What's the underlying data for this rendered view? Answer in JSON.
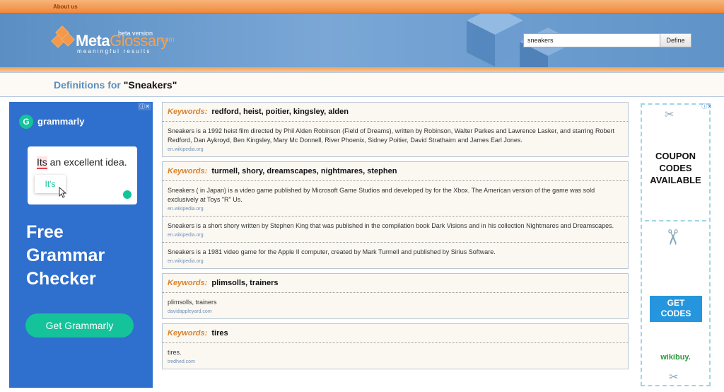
{
  "topbar": {
    "about": "About us"
  },
  "logo": {
    "meta": "Meta",
    "glossary": "Glossary",
    "beta": "beta version",
    "com": ".com",
    "tagline": "meaningful results"
  },
  "search": {
    "value": "sneakers",
    "button": "Define"
  },
  "heading": {
    "label": "Definitions for ",
    "term": "\"Sneakers\""
  },
  "ad_left": {
    "choices": "ⓘ✕",
    "brand": "grammarly",
    "sentence_underlined": "Its",
    "sentence_rest": " an excellent idea.",
    "suggestion": "It's",
    "headline_1": "Free",
    "headline_2": "Grammar",
    "headline_3": "Checker",
    "button": "Get Grammarly"
  },
  "keyword_label": "Keywords:",
  "cards": [
    {
      "keywords": "redford, heist, poitier, kingsley, alden",
      "entries": [
        {
          "text": "Sneakers is a 1992 heist film directed by Phil Alden Robinson (Field of Dreams), written by Robinson, Walter Parkes and Lawrence Lasker, and starring Robert Redford, Dan Aykroyd, Ben Kingsley, Mary Mc Donnell, River Phoenix, Sidney Poitier, David Strathairn and James Earl Jones.",
          "source": "en.wikipedia.org"
        }
      ]
    },
    {
      "keywords": "turmell, shory, dreamscapes, nightmares, stephen",
      "entries": [
        {
          "text": "Sneakers ( in Japan) is a video game published by Microsoft Game Studios and developed by for the Xbox. The American version of the game was sold exclusively at Toys \"R\" Us.",
          "source": "en.wikipedia.org"
        },
        {
          "text": "Sneakers is a short shory written by Stephen King that was published in the compilation book Dark Visions and in his collection Nightmares and Dreamscapes.",
          "source": "en.wikipedia.org"
        },
        {
          "text": "Sneakers is a 1981 video game for the Apple II computer, created by Mark Turmell and published by Sirius Software.",
          "source": "en.wikipedia.org"
        }
      ]
    },
    {
      "keywords": "plimsolls, trainers",
      "entries": [
        {
          "text": "plimsolls, trainers",
          "source": "davidappleyard.com"
        }
      ]
    },
    {
      "keywords": "tires",
      "entries": [
        {
          "text": "tires.",
          "source": "tredhed.com"
        }
      ]
    }
  ],
  "ad_right": {
    "choices": "ⓘ✕",
    "coupon_1": "COUPON",
    "coupon_2": "CODES",
    "coupon_3": "AVAILABLE",
    "get_1": "GET",
    "get_2": "CODES",
    "brand": "wikibuy."
  }
}
